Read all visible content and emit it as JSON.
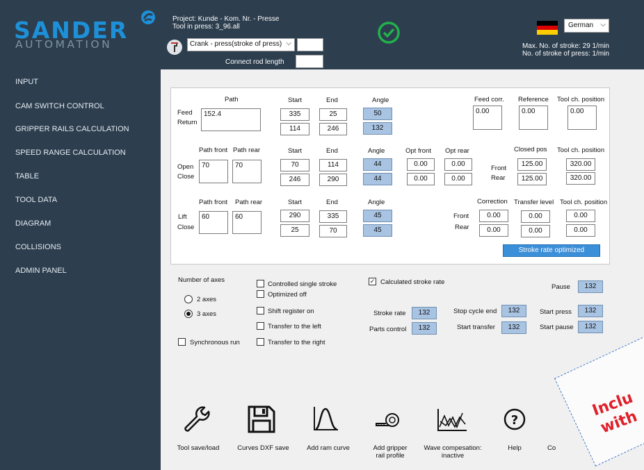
{
  "brand": {
    "line1": "SANDER",
    "line2": "AUTOMATION"
  },
  "sidebar": {
    "items": [
      {
        "label": "INPUT"
      },
      {
        "label": "CAM SWITCH CONTROL"
      },
      {
        "label": "GRIPPER RAILS CALCULATION"
      },
      {
        "label": "SPEED RANGE CALCULATION"
      },
      {
        "label": "TABLE"
      },
      {
        "label": "TOOL DATA"
      },
      {
        "label": "DIAGRAM"
      },
      {
        "label": "COLLISIONS"
      },
      {
        "label": "ADMIN PANEL"
      }
    ]
  },
  "header": {
    "project": "Project:  Kunde - Kom. Nr. - Presse",
    "tool": "Tool in press: 3_96.all",
    "press_type": "Crank - press(stroke of press)",
    "connect_rod": "Connect rod length",
    "language": "German",
    "max_stroke": "Max. No. of stroke:  29  1/min",
    "num_stroke": "No. of stroke of press:   1/min",
    "status_color": "#22b14c"
  },
  "feed": {
    "path_label": "Path",
    "start_label": "Start",
    "end_label": "End",
    "angle_label": "Angle",
    "feed_label": "Feed",
    "return_label": "Return",
    "path_value": "152.4",
    "feed_start": "335",
    "feed_end": "25",
    "feed_angle": "50",
    "return_start": "114",
    "return_end": "246",
    "return_angle": "132",
    "feedcorr_label": "Feed corr.",
    "reference_label": "Reference",
    "toolch_label": "Tool ch. position",
    "feedcorr": "0.00",
    "reference": "0.00",
    "toolch": "0.00"
  },
  "open": {
    "pathfront_label": "Path front",
    "pathrear_label": "Path rear",
    "start_label": "Start",
    "end_label": "End",
    "angle_label": "Angle",
    "optfront_label": "Opt front",
    "optrear_label": "Opt rear",
    "open_label": "Open",
    "close_label": "Close",
    "pathfront": "70",
    "pathrear": "70",
    "open_start": "70",
    "open_end": "114",
    "open_angle": "44",
    "open_optfront": "0.00",
    "open_optrear": "0.00",
    "close_start": "246",
    "close_end": "290",
    "close_angle": "44",
    "close_optfront": "0.00",
    "close_optrear": "0.00",
    "closedpos_label": "Closed pos",
    "toolch_label": "Tool ch. position",
    "front_label": "Front",
    "rear_label": "Rear",
    "front_closed": "125.00",
    "front_toolch": "320.00",
    "rear_closed": "125.00",
    "rear_toolch": "320.00"
  },
  "lift": {
    "pathfront_label": "Path front",
    "pathrear_label": "Path rear",
    "start_label": "Start",
    "end_label": "End",
    "angle_label": "Angle",
    "lift_label": "Lift",
    "close_label": "Close",
    "pathfront": "60",
    "pathrear": "60",
    "lift_start": "290",
    "lift_end": "335",
    "lift_angle": "45",
    "close_start": "25",
    "close_end": "70",
    "close_angle": "45",
    "correction_label": "Correction",
    "transfer_label": "Transfer level",
    "toolch_label": "Tool ch. position",
    "front_label": "Front",
    "rear_label": "Rear",
    "front_corr": "0.00",
    "front_transfer": "0.00",
    "front_toolch": "0.00",
    "rear_corr": "0.00",
    "rear_transfer": "0.00",
    "rear_toolch": "0.00",
    "optimized_btn": "Stroke rate optimized"
  },
  "options": {
    "axes_label": "Number of axes",
    "axes2": "2 axes",
    "axes3": "3 axes",
    "sync": "Synchronous run",
    "controlled": "Controlled single stroke",
    "optimized_off": "Optimized off",
    "shift": "Shift register on",
    "transfer_left": "Transfer to the left",
    "transfer_right": "Transfer to the right",
    "calc_stroke": "Calculated stroke rate",
    "pause": "Pause",
    "pause_val": "132",
    "stroke_rate": "Stroke rate",
    "stroke_rate_val": "132",
    "parts_control": "Parts control",
    "parts_control_val": "132",
    "stop_cycle": "Stop cycle end",
    "stop_cycle_val": "132",
    "start_transfer": "Start  transfer",
    "start_transfer_val": "132",
    "start_press": "Start press",
    "start_press_val": "132",
    "start_pause": "Start pause",
    "start_pause_val": "132"
  },
  "tools": {
    "save_load": "Tool save/load",
    "dxf": "Curves DXF save",
    "ram": "Add ram curve",
    "gripper1": "Add gripper",
    "gripper2": "rail profile",
    "wave1": "Wave compesation:",
    "wave2": "inactive",
    "help": "Help",
    "cut": "Co"
  },
  "stamp": {
    "line1": "Inclu",
    "line2": "with"
  }
}
